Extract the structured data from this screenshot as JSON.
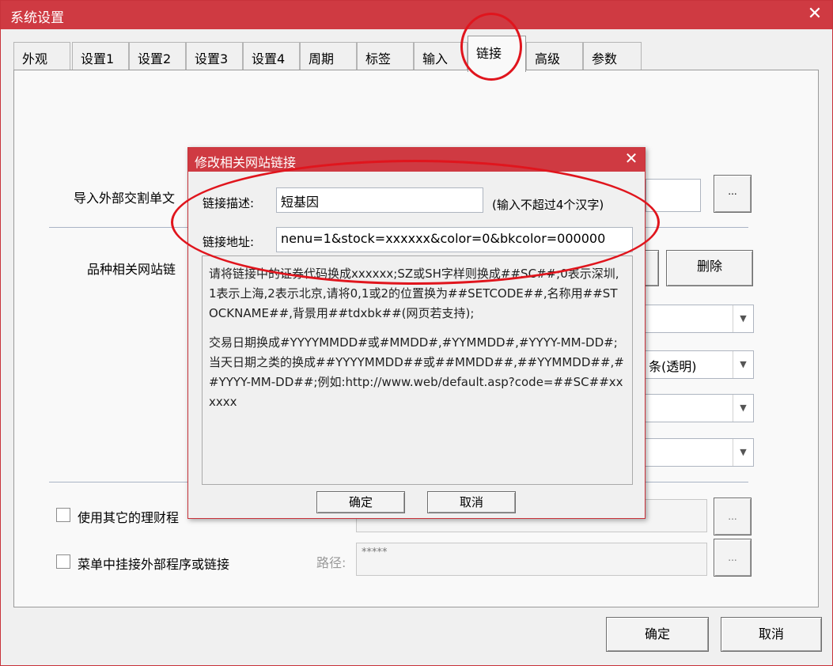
{
  "window": {
    "title": "系统设置",
    "close_glyph": "✕"
  },
  "tabs": [
    {
      "label": "外观"
    },
    {
      "label": "设置1"
    },
    {
      "label": "设置2"
    },
    {
      "label": "设置3"
    },
    {
      "label": "设置4"
    },
    {
      "label": "周期"
    },
    {
      "label": "标签"
    },
    {
      "label": "输入"
    },
    {
      "label": "链接",
      "active": true
    },
    {
      "label": "高级"
    },
    {
      "label": "参数"
    }
  ],
  "panel": {
    "import_label": "导入外部交割单文",
    "browse_glyph": "...",
    "site_link_label": "品种相关网站链",
    "delete_label": "删除",
    "combo2_value": "条(透明)",
    "use_other_label": "使用其它的理财程",
    "menu_external_label": "菜单中挂接外部程序或链接",
    "path_label": "路径:",
    "path_placeholder": "*****",
    "ok_label": "确定",
    "cancel_label": "取消"
  },
  "dialog": {
    "title": "修改相关网站链接",
    "close_glyph": "✕",
    "desc_label": "链接描述:",
    "desc_value": "短基因",
    "desc_hint": "(输入不超过4个汉字)",
    "addr_label": "链接地址:",
    "addr_value": "nenu=1&stock=xxxxxx&color=0&bkcolor=000000",
    "note_p1": "请将链接中的证券代码换成xxxxxx;SZ或SH字样则换成##SC##;0表示深圳,1表示上海,2表示北京,请将0,1或2的位置换为##SETCODE##,名称用##STOCKNAME##,背景用##tdxbk##(网页若支持);",
    "note_p2": "交易日期换成#YYYYMMDD#或#MMDD#,#YYMMDD#,#YYYY-MM-DD#;当天日期之类的换成##YYYYMMDD##或##MMDD##,##YYMMDD##,##YYYY-MM-DD##;例如:http://www.web/default.asp?code=##SC##xxxxxx",
    "ok_label": "确定",
    "cancel_label": "取消"
  },
  "colors": {
    "title_bar": "#cf3a42",
    "annotation": "#e0151d"
  }
}
